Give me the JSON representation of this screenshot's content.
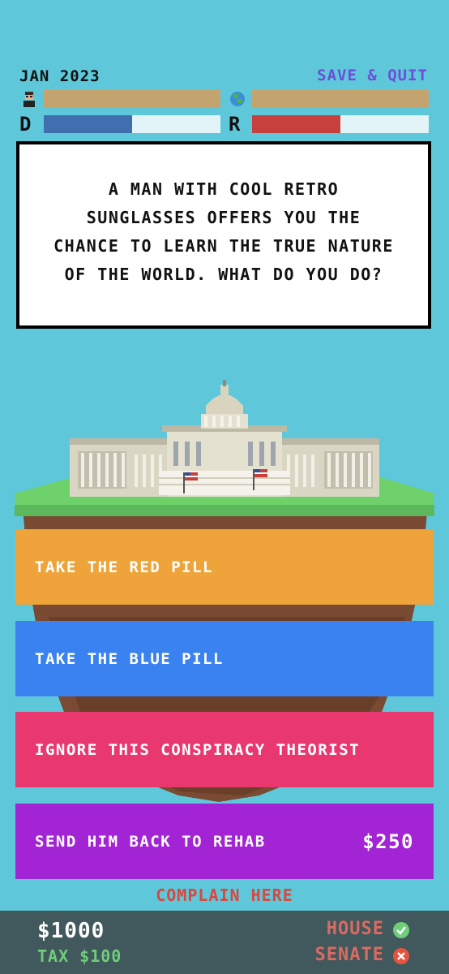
{
  "header": {
    "date": "JAN 2023",
    "save_quit": "SAVE & QUIT"
  },
  "stats": {
    "personal_icon": "person-icon",
    "world_icon": "globe-icon",
    "personal_level": 1.0,
    "world_level": 1.0,
    "dem_label": "D",
    "rep_label": "R",
    "dem_level": 0.5,
    "rep_level": 0.5,
    "colors": {
      "tan": "#c4a46e",
      "blue": "#3f6fae",
      "red": "#c7403d",
      "empty": "#e2f4f8"
    }
  },
  "story": {
    "text": "A MAN WITH COOL RETRO SUNGLASSES OFFERS YOU THE CHANCE TO LEARN THE TRUE NATURE OF THE WORLD. WHAT DO YOU DO?"
  },
  "choices": [
    {
      "label": "TAKE THE RED PILL",
      "cost": "",
      "color": "#eea43a"
    },
    {
      "label": "TAKE THE BLUE PILL",
      "cost": "",
      "color": "#3a82f0"
    },
    {
      "label": "IGNORE THIS CONSPIRACY THEORIST",
      "cost": "",
      "color": "#e8386f"
    },
    {
      "label": "SEND HIM BACK TO REHAB",
      "cost": "$250",
      "color": "#a324d4"
    }
  ],
  "complain": "COMPLAIN HERE",
  "footer": {
    "money": "$1000",
    "tax": "TAX $100",
    "house": "HOUSE",
    "senate": "SENATE",
    "house_status": "check-icon",
    "senate_status": "x-icon"
  }
}
